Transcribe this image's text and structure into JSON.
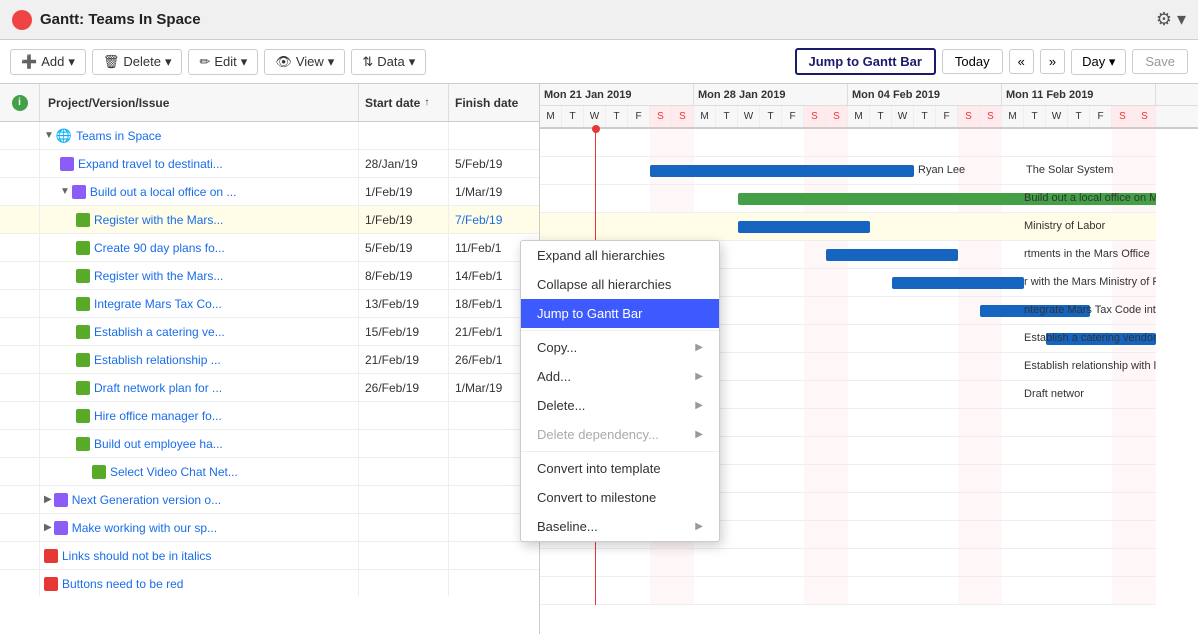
{
  "app": {
    "title": "Gantt:  Teams In Space"
  },
  "toolbar": {
    "add_label": "Add",
    "delete_label": "Delete",
    "edit_label": "Edit",
    "view_label": "View",
    "data_label": "Data",
    "jump_label": "Jump to Gantt Bar",
    "today_label": "Today",
    "prev_label": "«",
    "next_label": "»",
    "day_label": "Day",
    "save_label": "Save"
  },
  "table": {
    "col_issue": "Project/Version/Issue",
    "col_start": "Start date",
    "col_finish": "Finish date",
    "rows": [
      {
        "indent": 1,
        "type": "project",
        "label": "Teams in Space",
        "start": "",
        "finish": "",
        "icon": "globe",
        "expandable": true,
        "expanded": true
      },
      {
        "indent": 2,
        "type": "story",
        "label": "Expand travel to destinati...",
        "start": "28/Jan/19",
        "finish": "5/Feb/19",
        "icon": "purple"
      },
      {
        "indent": 2,
        "type": "story",
        "label": "Build out a local office on ...",
        "start": "1/Feb/19",
        "finish": "1/Mar/19",
        "icon": "purple",
        "expandable": true,
        "expanded": true
      },
      {
        "indent": 3,
        "type": "subtask",
        "label": "Register with the Mars...",
        "start": "1/Feb/19",
        "finish": "7/Feb/19",
        "icon": "green",
        "selected": true
      },
      {
        "indent": 3,
        "type": "subtask",
        "label": "Create 90 day plans fo...",
        "start": "5/Feb/19",
        "finish": "11/Feb/1",
        "icon": "green"
      },
      {
        "indent": 3,
        "type": "subtask",
        "label": "Register with the Mars...",
        "start": "8/Feb/19",
        "finish": "14/Feb/1",
        "icon": "green"
      },
      {
        "indent": 3,
        "type": "subtask",
        "label": "Integrate Mars Tax Co...",
        "start": "13/Feb/19",
        "finish": "18/Feb/1",
        "icon": "green"
      },
      {
        "indent": 3,
        "type": "subtask",
        "label": "Establish a catering ve...",
        "start": "15/Feb/19",
        "finish": "21/Feb/1",
        "icon": "green"
      },
      {
        "indent": 3,
        "type": "subtask",
        "label": "Establish relationship ...",
        "start": "21/Feb/19",
        "finish": "26/Feb/1",
        "icon": "green"
      },
      {
        "indent": 3,
        "type": "subtask",
        "label": "Draft network plan for ...",
        "start": "26/Feb/19",
        "finish": "1/Mar/19",
        "icon": "green"
      },
      {
        "indent": 3,
        "type": "subtask",
        "label": "Hire office manager fo...",
        "start": "",
        "finish": "",
        "icon": "green"
      },
      {
        "indent": 3,
        "type": "subtask",
        "label": "Build out employee ha...",
        "start": "",
        "finish": "",
        "icon": "green"
      },
      {
        "indent": 4,
        "type": "subtask",
        "label": "Select Video Chat Net...",
        "start": "",
        "finish": "",
        "icon": "green"
      },
      {
        "indent": 1,
        "type": "version",
        "label": "Next Generation version o...",
        "start": "",
        "finish": "",
        "icon": "purple",
        "expandable": true,
        "expanded": false
      },
      {
        "indent": 1,
        "type": "version",
        "label": "Make working with our sp...",
        "start": "",
        "finish": "",
        "icon": "purple",
        "expandable": true,
        "expanded": false
      },
      {
        "indent": 1,
        "type": "bug",
        "label": "Links should not be in italics",
        "start": "",
        "finish": "",
        "icon": "red"
      },
      {
        "indent": 1,
        "type": "bug",
        "label": "Buttons need to be red",
        "start": "",
        "finish": "",
        "icon": "red"
      }
    ]
  },
  "gantt": {
    "weeks": [
      {
        "label": "Mon 21 Jan 2019",
        "days": 7
      },
      {
        "label": "Mon 28 Jan 2019",
        "days": 7
      },
      {
        "label": "Mon 04 Feb 2019",
        "days": 7
      },
      {
        "label": "Mon 11 Feb 2019",
        "days": 7
      }
    ],
    "days": [
      "M",
      "T",
      "W",
      "T",
      "F",
      "S",
      "S",
      "M",
      "T",
      "W",
      "T",
      "F",
      "S",
      "S",
      "M",
      "T",
      "W",
      "T",
      "F",
      "S",
      "S",
      "M",
      "T",
      "W",
      "T",
      "F",
      "S",
      "S"
    ],
    "weekend_days": [
      5,
      6,
      12,
      13,
      19,
      20,
      26,
      27
    ]
  },
  "context_menu": {
    "items": [
      {
        "label": "Expand all hierarchies",
        "hasArrow": false,
        "disabled": false
      },
      {
        "label": "Collapse all hierarchies",
        "hasArrow": false,
        "disabled": false
      },
      {
        "label": "Jump to Gantt Bar",
        "hasArrow": false,
        "disabled": false,
        "highlighted": true
      },
      {
        "label": "Copy...",
        "hasArrow": true,
        "disabled": false
      },
      {
        "label": "Add...",
        "hasArrow": true,
        "disabled": false
      },
      {
        "label": "Delete...",
        "hasArrow": true,
        "disabled": false
      },
      {
        "label": "Delete dependency...",
        "hasArrow": true,
        "disabled": true
      },
      {
        "label": "Convert into template",
        "hasArrow": false,
        "disabled": false
      },
      {
        "label": "Convert to milestone",
        "hasArrow": false,
        "disabled": false
      },
      {
        "label": "Baseline...",
        "hasArrow": true,
        "disabled": false
      }
    ]
  }
}
